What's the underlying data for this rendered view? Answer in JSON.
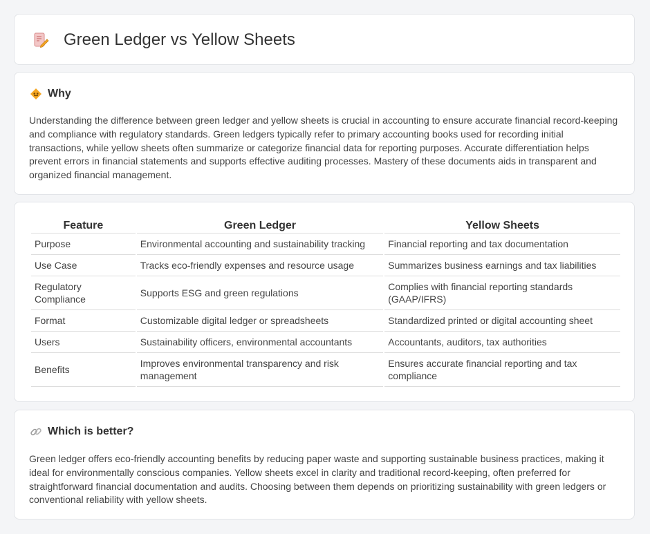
{
  "header": {
    "title": "Green Ledger vs Yellow Sheets",
    "icon": "document-pencil-icon"
  },
  "why": {
    "title": "Why",
    "icon": "diamond-warning-icon",
    "text": "Understanding the difference between green ledger and yellow sheets is crucial in accounting to ensure accurate financial record-keeping and compliance with regulatory standards. Green ledgers typically refer to primary accounting books used for recording initial transactions, while yellow sheets often summarize or categorize financial data for reporting purposes. Accurate differentiation helps prevent errors in financial statements and supports effective auditing processes. Mastery of these documents aids in transparent and organized financial management."
  },
  "table": {
    "headers": [
      "Feature",
      "Green Ledger",
      "Yellow Sheets"
    ],
    "rows": [
      [
        "Purpose",
        "Environmental accounting and sustainability tracking",
        "Financial reporting and tax documentation"
      ],
      [
        "Use Case",
        "Tracks eco-friendly expenses and resource usage",
        "Summarizes business earnings and tax liabilities"
      ],
      [
        "Regulatory Compliance",
        "Supports ESG and green regulations",
        "Complies with financial reporting standards (GAAP/IFRS)"
      ],
      [
        "Format",
        "Customizable digital ledger or spreadsheets",
        "Standardized printed or digital accounting sheet"
      ],
      [
        "Users",
        "Sustainability officers, environmental accountants",
        "Accountants, auditors, tax authorities"
      ],
      [
        "Benefits",
        "Improves environmental transparency and risk management",
        "Ensures accurate financial reporting and tax compliance"
      ]
    ]
  },
  "better": {
    "title": "Which is better?",
    "icon": "link-icon",
    "text": "Green ledger offers eco-friendly accounting benefits by reducing paper waste and supporting sustainable business practices, making it ideal for environmentally conscious companies. Yellow sheets excel in clarity and traditional record-keeping, often preferred for straightforward financial documentation and audits. Choosing between them depends on prioritizing sustainability with green ledgers or conventional reliability with yellow sheets."
  },
  "colors": {
    "background": "#f4f5f7",
    "card": "#ffffff",
    "border": "#e2e4e8",
    "accent_orange": "#f5a623",
    "icon_pink": "#e8a0a0"
  }
}
